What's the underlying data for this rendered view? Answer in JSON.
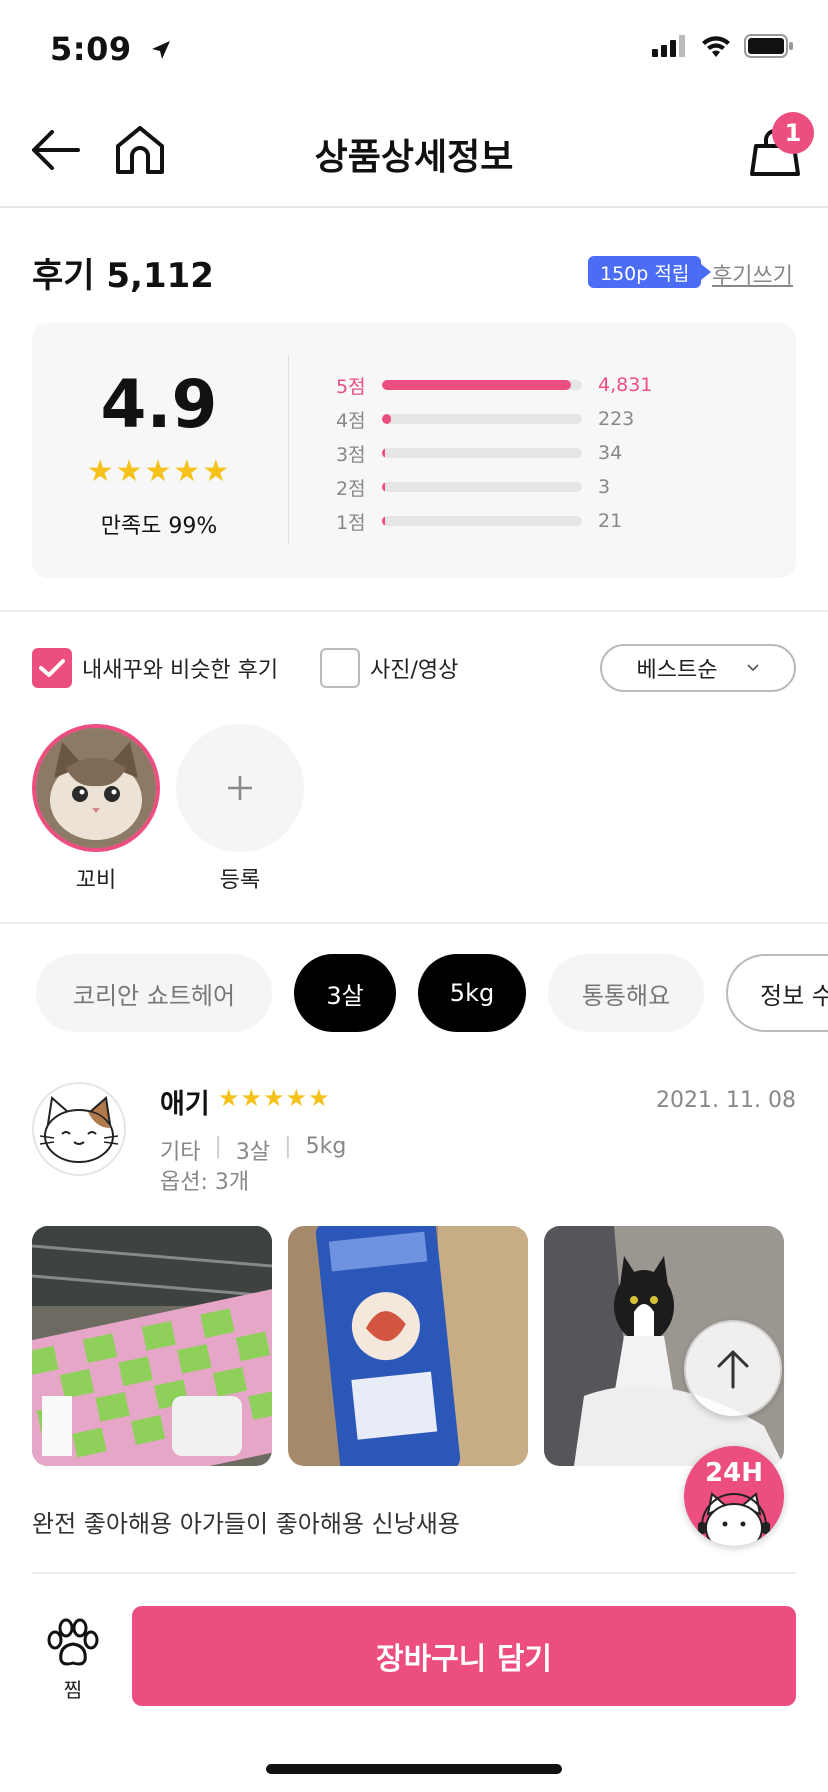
{
  "status_bar": {
    "time": "5:09"
  },
  "nav": {
    "title": "상품상세정보",
    "cart_count": "1"
  },
  "reviews": {
    "title": "후기 5,112",
    "point_badge": "150p 적립",
    "write_link": "후기쓰기",
    "average": "4.9",
    "stars": "★★★★★",
    "satisfaction": "만족도 99%",
    "distribution": [
      {
        "label": "5점",
        "count": "4,831",
        "fraction": 0.945
      },
      {
        "label": "4점",
        "count": "223",
        "fraction": 0.044
      },
      {
        "label": "3점",
        "count": "34",
        "fraction": 0.007
      },
      {
        "label": "2점",
        "count": "3",
        "fraction": 0.001
      },
      {
        "label": "1점",
        "count": "21",
        "fraction": 0.004
      }
    ]
  },
  "filters": {
    "similar_label": "내새꾸와 비슷한 후기",
    "similar_checked": true,
    "photo_label": "사진/영상",
    "photo_checked": false,
    "sort_value": "베스트순"
  },
  "pets": {
    "pet_name": "꼬비",
    "add_label": "등록"
  },
  "chips": [
    "코리안 쇼트헤어",
    "3살",
    "5kg",
    "통통해요",
    "정보 수"
  ],
  "review_item": {
    "name": "애기",
    "stars": "★★★★★",
    "date": "2021. 11. 08",
    "meta": [
      "기타",
      "3살",
      "5kg"
    ],
    "option": "옵션: 3개",
    "text": "완전 좋아해용 아가들이 좋아해용 신낭새용"
  },
  "floating": {
    "chat_label": "24H"
  },
  "bottom_bar": {
    "wish_label": "찜",
    "cart_button": "장바구니 담기"
  },
  "colors": {
    "accent": "#ec4f7f",
    "badge_blue": "#4b6cf5",
    "star": "#f5c21b"
  }
}
